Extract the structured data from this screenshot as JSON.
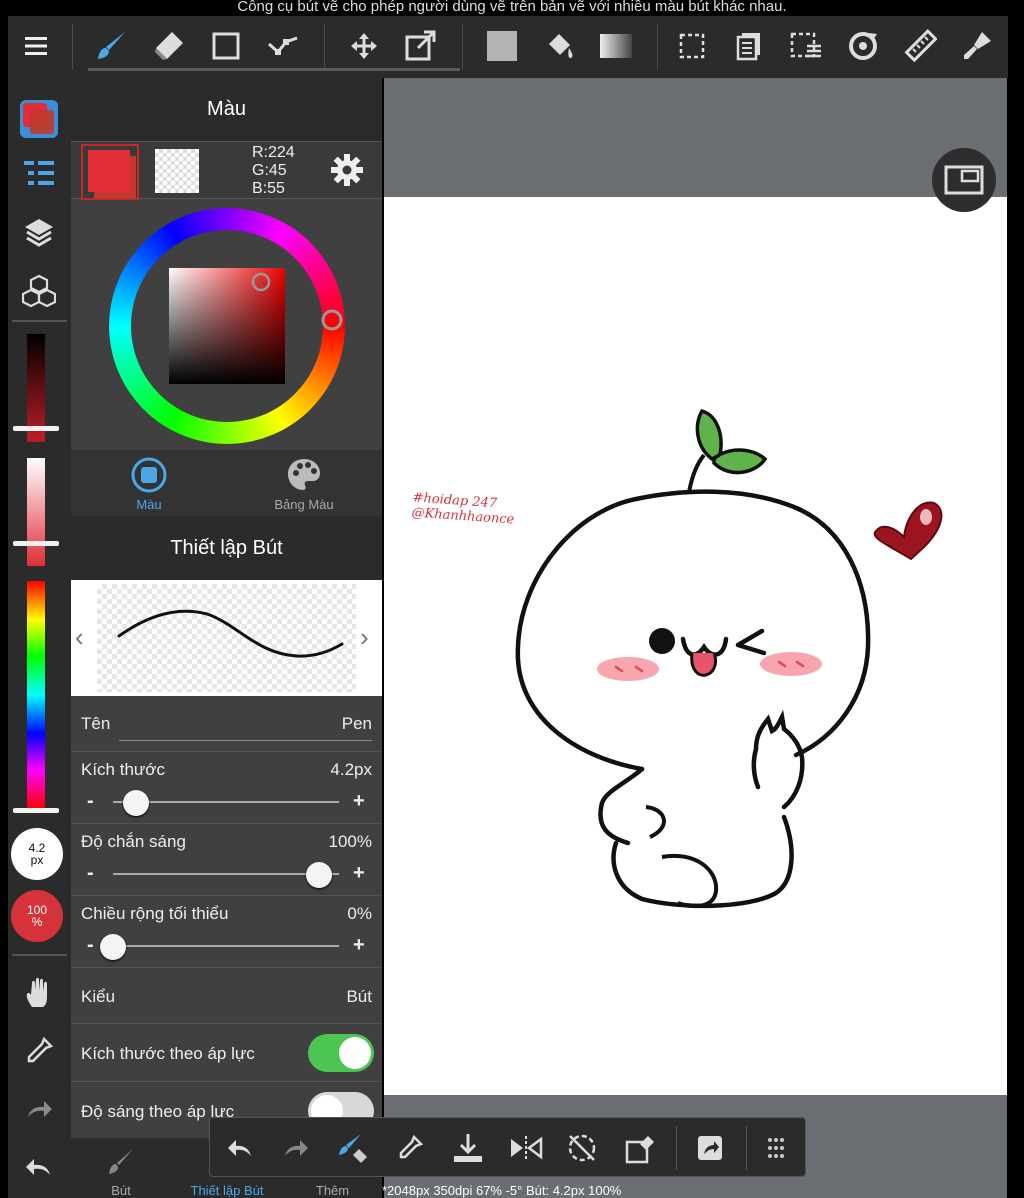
{
  "caption": "Công cụ bút vẽ cho phép người dùng vẽ trên bản vẽ với nhiều màu bút khác nhau.",
  "toolbar": {
    "tools": [
      "menu-icon",
      "brush-icon",
      "eraser-icon",
      "rect-select-icon",
      "vector-icon",
      "move-icon",
      "transform-icon",
      "fill-color-icon",
      "bucket-icon",
      "gradient-icon",
      "selection-icon",
      "layer-panel-icon",
      "select-menu-icon",
      "rotate-icon",
      "ruler-icon",
      "pen-tip-icon"
    ]
  },
  "rail": {
    "brush_size": {
      "value": "4.2",
      "unit": "px"
    },
    "opacity": {
      "value": "100",
      "unit": "%"
    }
  },
  "color_panel": {
    "title": "Màu",
    "rgb": {
      "r": "R:224",
      "g": "G:45",
      "b": "B:55"
    },
    "foreground_color": "#e02d37",
    "tabs": [
      {
        "label": "Màu",
        "active": true
      },
      {
        "label": "Bảng Màu",
        "active": false
      }
    ]
  },
  "pen_settings": {
    "title": "Thiết lập Bút",
    "name": {
      "label": "Tên",
      "value": "Pen"
    },
    "size": {
      "label": "Kích thước",
      "value": "4.2px",
      "level": 0.11
    },
    "opacity": {
      "label": "Độ chắn sáng",
      "value": "100%",
      "level": 1.0
    },
    "min_width": {
      "label": "Chiều rộng tối thiểu",
      "value": "0%",
      "level": 0.0
    },
    "type": {
      "label": "Kiểu",
      "value": "Bút"
    },
    "pressure_size": {
      "label": "Kích thước theo áp lực",
      "on": true
    },
    "pressure_opacity": {
      "label": "Độ sáng theo áp lực",
      "on": false
    }
  },
  "bottom_tabs": [
    {
      "label": "Bút",
      "active": false
    },
    {
      "label": "Thiết lập Bút",
      "active": true
    },
    {
      "label": "Thêm",
      "active": false
    }
  ],
  "canvas": {
    "status": "*2048px 350dpi 67% -5° Bút: 4.2px 100%",
    "watermark_line1": "#hoidap 247",
    "watermark_line2": "@Khanhhaonce"
  },
  "colors": {
    "accent": "#4aa8e8",
    "toggle_on": "#4cc552",
    "panel_bg": "#404040",
    "toolbar_bg": "#2b2b2b"
  }
}
